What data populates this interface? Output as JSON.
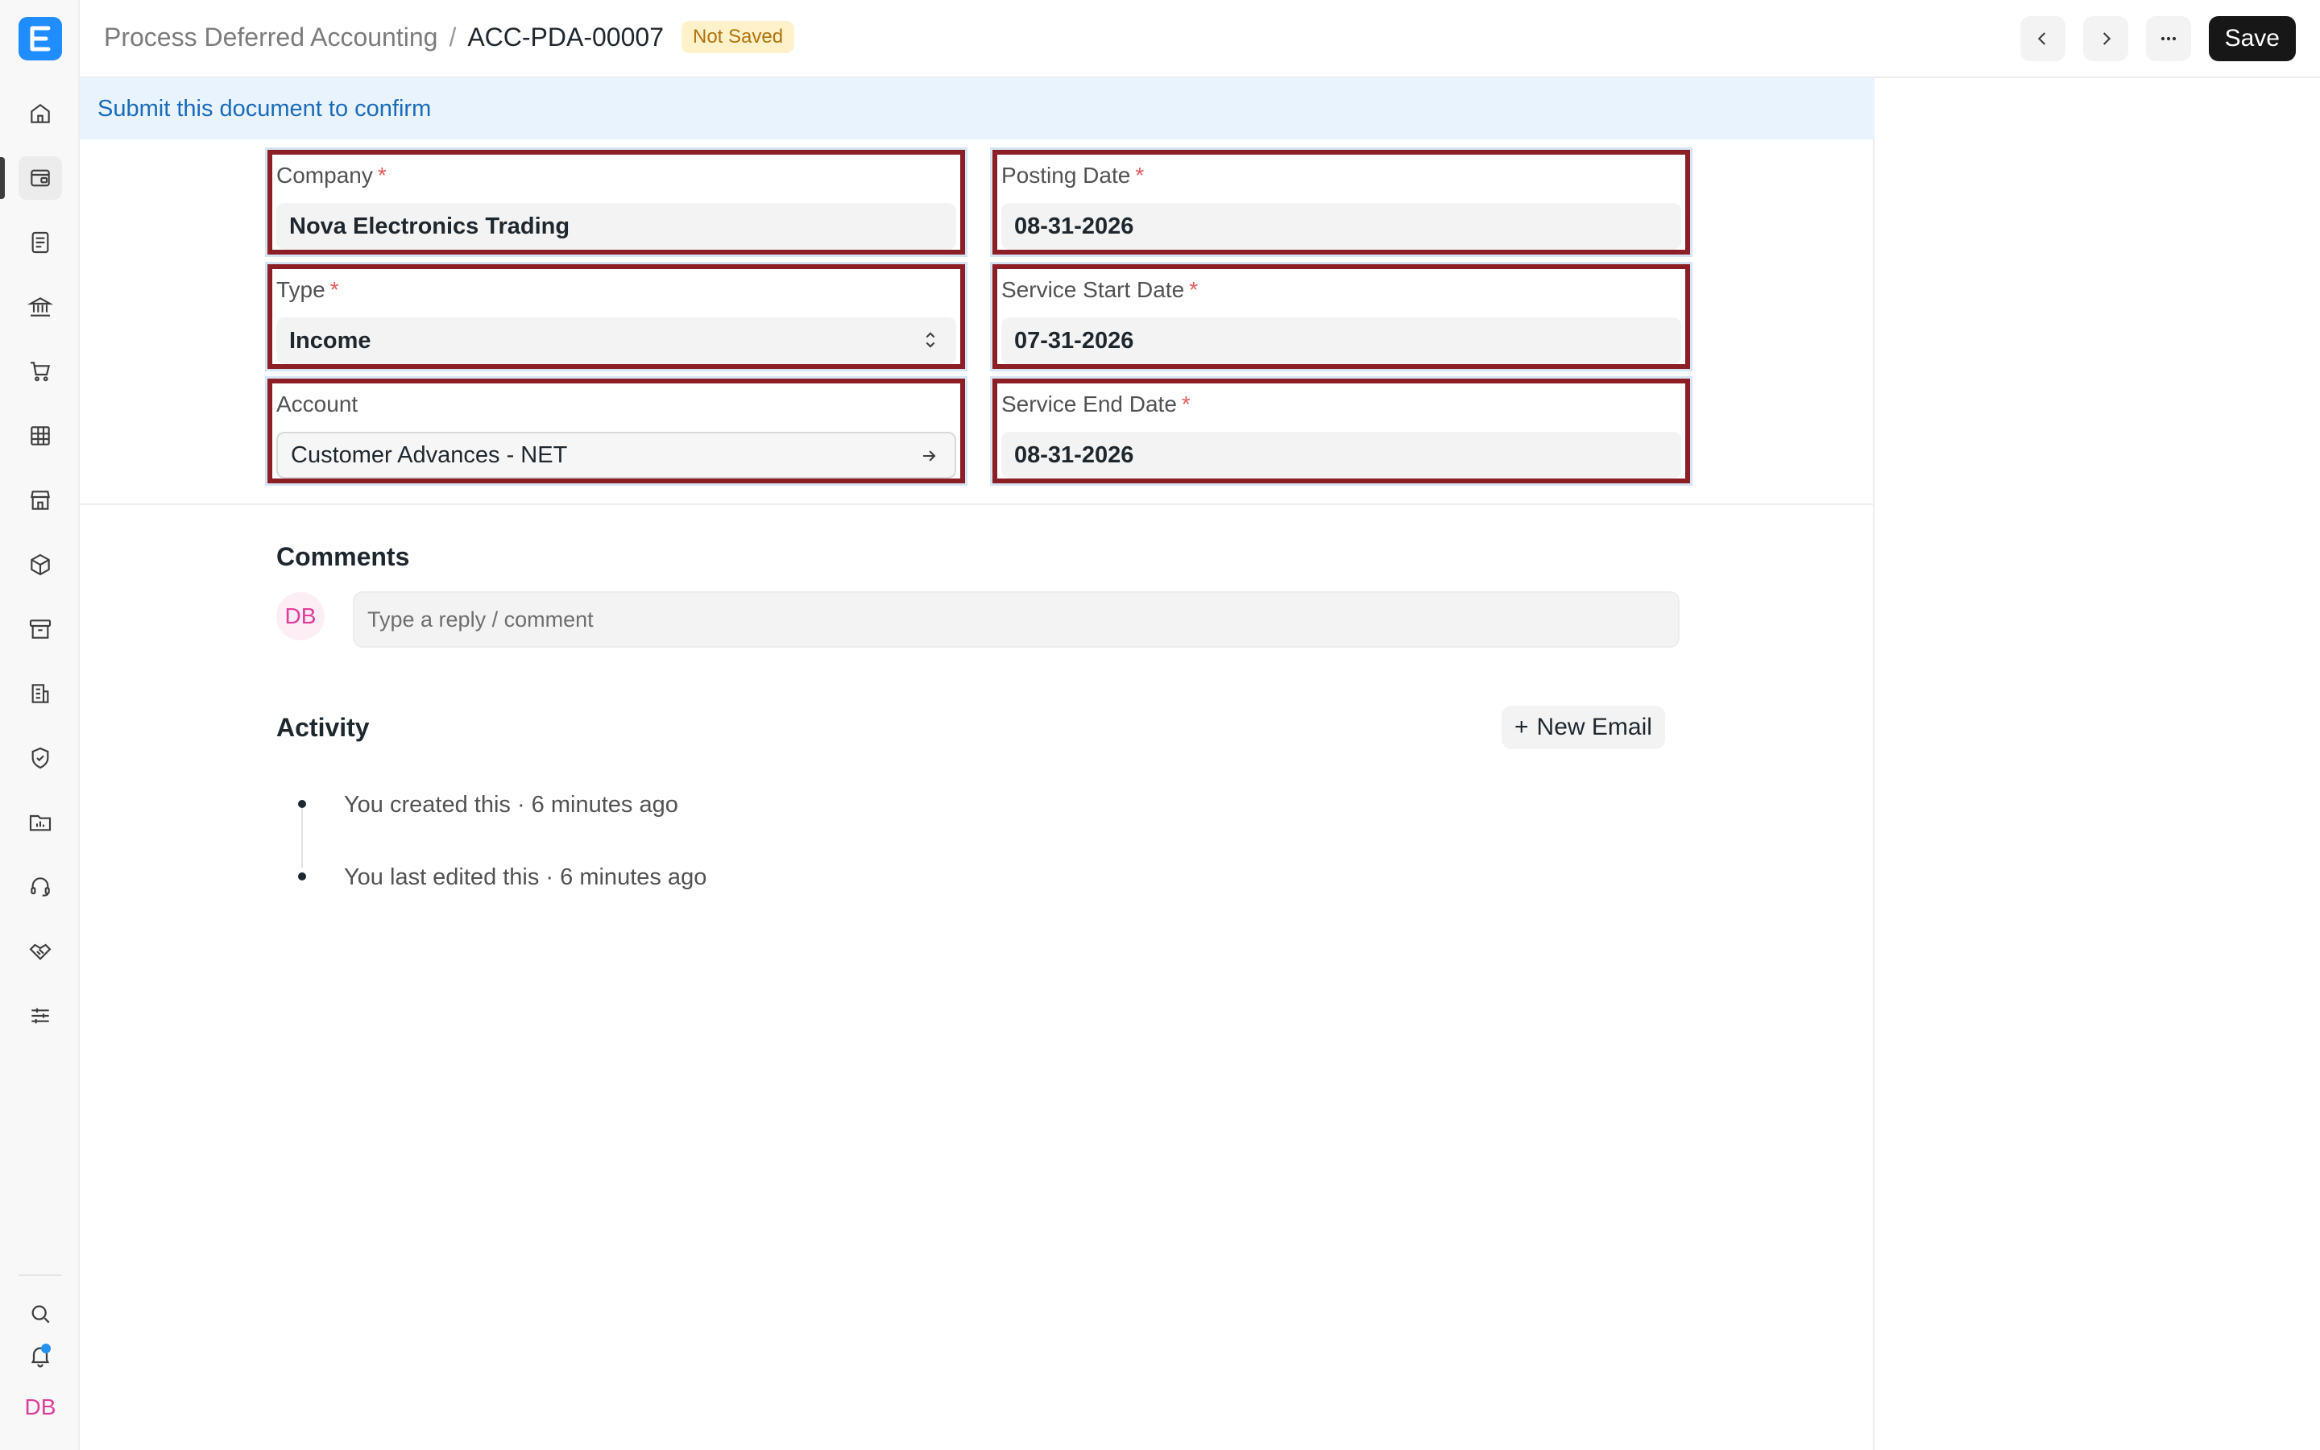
{
  "app": {
    "logo_letter": "E",
    "user_initials": "DB"
  },
  "sidebar": {
    "items": [
      {
        "icon": "home-icon"
      },
      {
        "icon": "accounting-icon",
        "active": true
      },
      {
        "icon": "document-icon"
      },
      {
        "icon": "bank-icon"
      },
      {
        "icon": "cart-icon"
      },
      {
        "icon": "table-icon"
      },
      {
        "icon": "store-icon"
      },
      {
        "icon": "package-icon"
      },
      {
        "icon": "archive-icon"
      },
      {
        "icon": "building-icon"
      },
      {
        "icon": "shield-icon"
      },
      {
        "icon": "folder-chart-icon"
      },
      {
        "icon": "headset-icon"
      },
      {
        "icon": "handshake-icon"
      },
      {
        "icon": "sliders-icon"
      }
    ],
    "bottom": [
      {
        "icon": "search-icon"
      },
      {
        "icon": "bell-icon"
      }
    ]
  },
  "header": {
    "breadcrumb_parent": "Process Deferred Accounting",
    "breadcrumb_sep": "/",
    "doc_id": "ACC-PDA-00007",
    "status_badge": "Not Saved",
    "save_label": "Save"
  },
  "banner": {
    "text": "Submit this document to confirm"
  },
  "form": {
    "company": {
      "label": "Company",
      "required": "*",
      "value": "Nova Electronics Trading"
    },
    "posting_date": {
      "label": "Posting Date",
      "required": "*",
      "value": "08-31-2026"
    },
    "type": {
      "label": "Type",
      "required": "*",
      "value": "Income"
    },
    "service_start_date": {
      "label": "Service Start Date",
      "required": "*",
      "value": "07-31-2026"
    },
    "account": {
      "label": "Account",
      "value": "Customer Advances - NET"
    },
    "service_end_date": {
      "label": "Service End Date",
      "required": "*",
      "value": "08-31-2026"
    }
  },
  "comments": {
    "title": "Comments",
    "avatar": "DB",
    "placeholder": "Type a reply / comment"
  },
  "activity": {
    "title": "Activity",
    "new_email_label": "New Email",
    "new_email_prefix": "+",
    "items": [
      {
        "text": "You created this · 6 minutes ago"
      },
      {
        "text": "You last edited this · 6 minutes ago"
      }
    ]
  },
  "colors": {
    "accent": "#1f8cff",
    "field_highlight": "#8c1f26",
    "banner_bg": "#e8f3fd",
    "badge_bg": "#fff1c9"
  }
}
